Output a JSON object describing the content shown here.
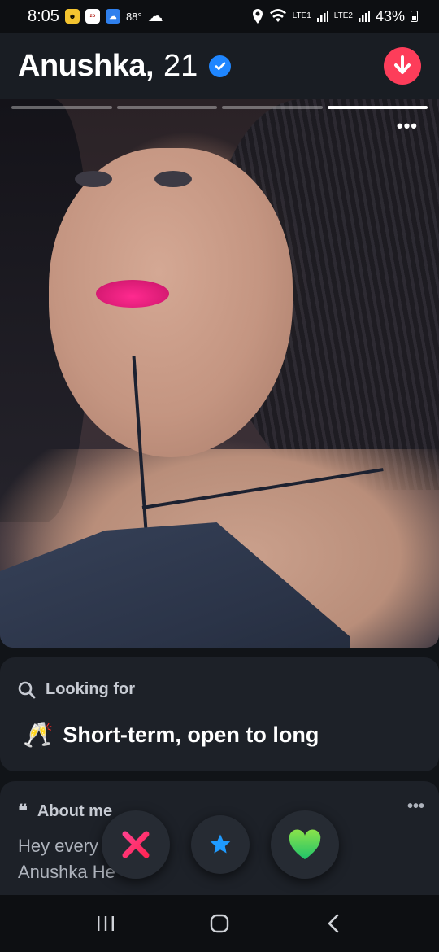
{
  "status_bar": {
    "time": "8:05",
    "temperature": "88°",
    "lte1": "LTE1",
    "lte2": "LTE2",
    "battery": "43%"
  },
  "profile": {
    "name": "Anushka,",
    "age": "21",
    "verified": true
  },
  "photo": {
    "count": 4,
    "active_index": 3
  },
  "looking_for": {
    "label": "Looking for",
    "value": "Short-term, open to long",
    "emoji": "🥂"
  },
  "about_me": {
    "label": "About me",
    "text_line1": "Hey every",
    "text_line2": "Anushka He",
    "more": "•••"
  },
  "colors": {
    "accent_red": "#fd3d5a",
    "verified_blue": "#1f86ff",
    "nope": "#ff2d6f",
    "super_like": "#1f9bff",
    "like": "#3bd66b"
  }
}
